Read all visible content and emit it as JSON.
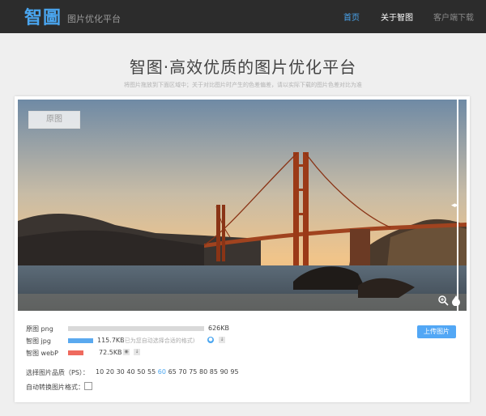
{
  "header": {
    "logo": "智圖",
    "subtitle": "图片优化平台",
    "nav": [
      {
        "label": "首页"
      },
      {
        "label": "关于智图"
      },
      {
        "label": "客户端下载"
      }
    ]
  },
  "main": {
    "title": "智图·高效优质的图片优化平台",
    "subtitle": "将图片拖放到下面区域中；关于对比图片时产生的色差偏差，请以实际下载的图片色差对比为准"
  },
  "viewer": {
    "original_tag": "原图",
    "handle": "◂▸"
  },
  "results": {
    "rows": [
      {
        "label": "原图 png",
        "size": "626KB",
        "ratio": 1.0,
        "color": "#d9d9d9",
        "note": ""
      },
      {
        "label": "智图 jpg",
        "size": "115.7KB",
        "ratio": 0.185,
        "color": "#5aa9ef",
        "note": "(已为您自动选择合适的格式)"
      },
      {
        "label": "智图 webP",
        "size": "72.5KB",
        "ratio": 0.116,
        "color": "#ef6a5e",
        "note": ""
      }
    ],
    "upload_button": "上传图片"
  },
  "quality": {
    "label": "选择图片品质（PS）：",
    "options": [
      "10",
      "20",
      "30",
      "40",
      "50",
      "55",
      "60",
      "65",
      "70",
      "75",
      "80",
      "85",
      "90",
      "95"
    ],
    "selected": "60"
  },
  "auto_convert": {
    "label": "自动转换图片格式："
  }
}
